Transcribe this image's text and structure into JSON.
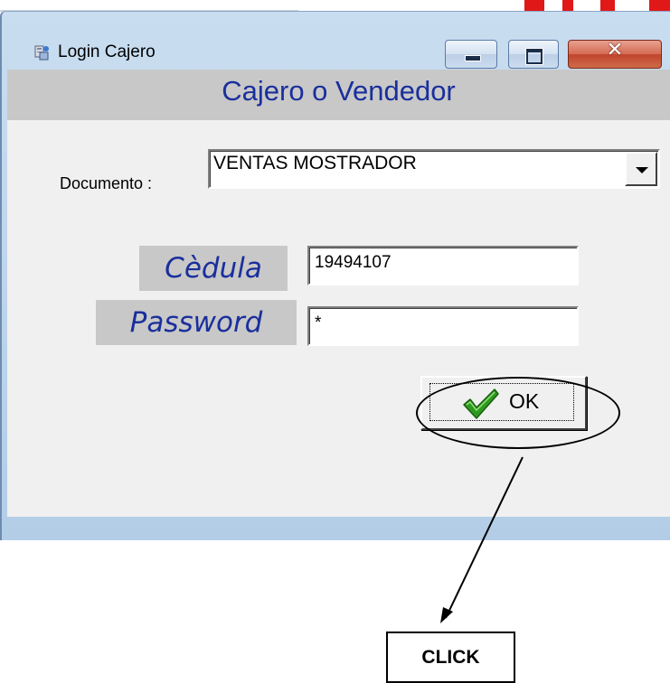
{
  "window": {
    "title": "Login Cajero",
    "close_glyph": "✕"
  },
  "form": {
    "heading": "Cajero o Vendedor",
    "documento_label": "Documento :",
    "documento_value": "VENTAS MOSTRADOR",
    "cedula_label": "Cèdula",
    "cedula_value": "19494107",
    "password_label": "Password",
    "password_value": "*",
    "ok_label": "OK"
  },
  "annotation": {
    "click_label": "CLICK"
  },
  "icons": {
    "app": "login-cajero-app-icon",
    "minimize": "minimize-icon",
    "maximize": "maximize-icon",
    "close": "close-icon",
    "dropdown": "chevron-down-icon",
    "ok": "checkmark-icon"
  },
  "colors": {
    "heading_text": "#1a2f9c",
    "label_band": "#c8c8c8",
    "checkmark": "#2e9a1e",
    "close_button": "#c0452c"
  }
}
